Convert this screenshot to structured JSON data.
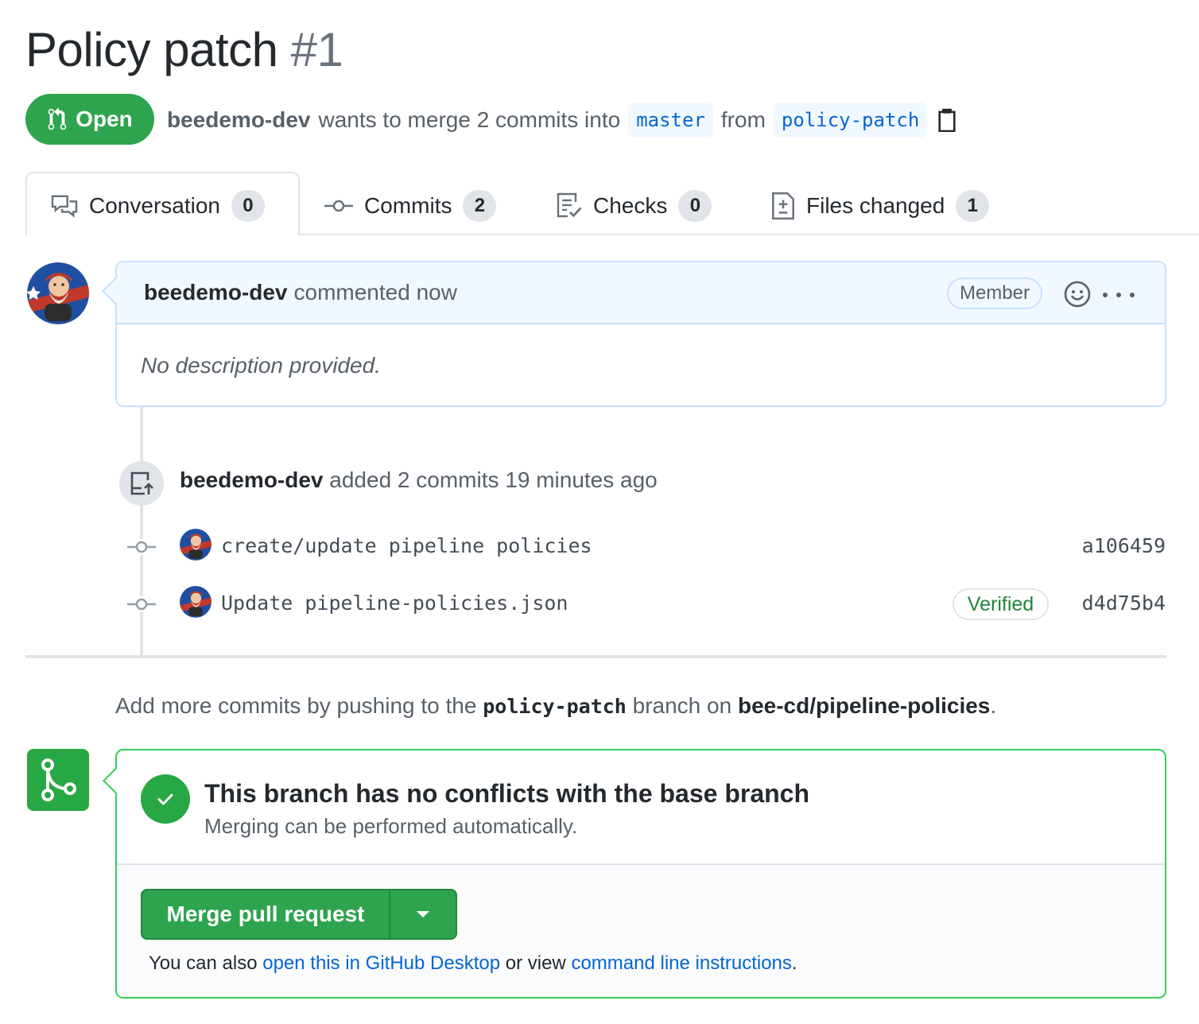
{
  "pr": {
    "title": "Policy patch",
    "number": "#1",
    "state": "Open",
    "author": "beedemo-dev",
    "merge_text": "wants to merge 2 commits into",
    "base_branch": "master",
    "from_text": "from",
    "head_branch": "policy-patch"
  },
  "tabs": [
    {
      "label": "Conversation",
      "count": "0",
      "icon": "comment-discussion-icon"
    },
    {
      "label": "Commits",
      "count": "2",
      "icon": "git-commit-icon"
    },
    {
      "label": "Checks",
      "count": "0",
      "icon": "checklist-icon"
    },
    {
      "label": "Files changed",
      "count": "1",
      "icon": "file-diff-icon"
    }
  ],
  "comment": {
    "author": "beedemo-dev",
    "meta": "commented now",
    "badge": "Member",
    "body": "No description provided."
  },
  "push_event": {
    "author": "beedemo-dev",
    "text": "added 2 commits 19 minutes ago"
  },
  "commits": [
    {
      "message": "create/update pipeline policies",
      "sha": "a106459",
      "verified": ""
    },
    {
      "message": "Update pipeline-policies.json",
      "sha": "d4d75b4",
      "verified": "Verified"
    }
  ],
  "add_more": {
    "prefix": "Add more commits by pushing to the",
    "branch": "policy-patch",
    "middle": "branch on",
    "repo": "bee-cd/pipeline-policies",
    "suffix": "."
  },
  "merge": {
    "title": "This branch has no conflicts with the base branch",
    "subtitle": "Merging can be performed automatically.",
    "button": "Merge pull request",
    "hint_prefix": "You can also",
    "hint_link1": "open this in GitHub Desktop",
    "hint_middle": "or view",
    "hint_link2": "command line instructions",
    "hint_suffix": "."
  },
  "colors": {
    "green": "#2ea44f",
    "link": "#0366d6",
    "verified": "#22863a"
  }
}
